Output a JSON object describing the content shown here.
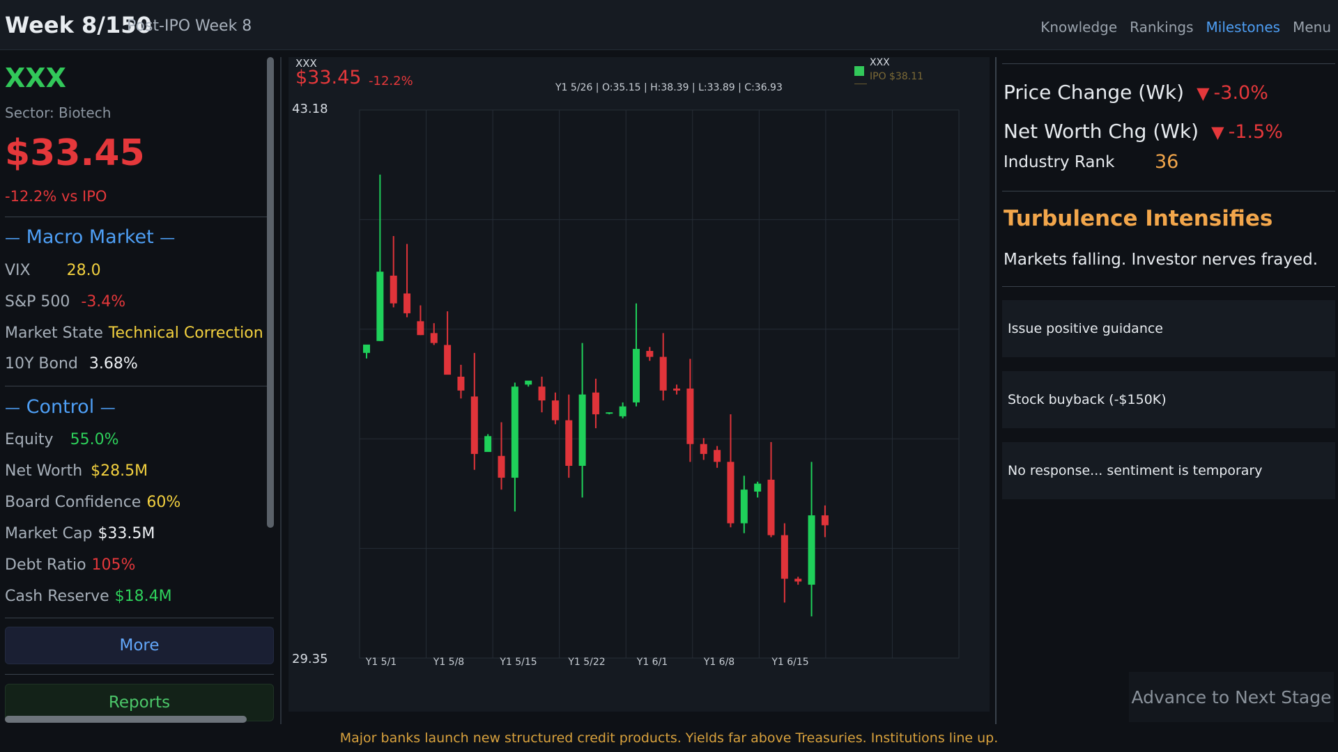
{
  "header": {
    "week": "Week 8/150",
    "subtitle": "Post-IPO Week 8",
    "nav": [
      "Knowledge",
      "Rankings",
      "Milestones",
      "Menu"
    ]
  },
  "company": {
    "ticker": "XXX",
    "sector": "Sector: Biotech",
    "price": "$33.45",
    "vs_ipo": "-12.2% vs IPO"
  },
  "macro": {
    "heading": "Macro Market",
    "rows": [
      {
        "label": "VIX",
        "value": "28.0",
        "color": "#f3d13f"
      },
      {
        "label": "S&P 500",
        "value": "-3.4%",
        "color": "#e5383b"
      },
      {
        "label": "Market State",
        "value": "Technical Correction",
        "color": "#f3d13f"
      },
      {
        "label": "10Y Bond",
        "value": "3.68%",
        "color": "#eef1f4"
      }
    ]
  },
  "control": {
    "heading": "Control",
    "rows": [
      {
        "label": "Equity",
        "value": "55.0%",
        "color": "#2ed15b"
      },
      {
        "label": "Net Worth",
        "value": "$28.5M",
        "color": "#f3d13f"
      },
      {
        "label": "Board Confidence",
        "value": "60%",
        "color": "#f3d13f"
      },
      {
        "label": "Market Cap",
        "value": "$33.5M",
        "color": "#eef1f4"
      },
      {
        "label": "Debt Ratio",
        "value": "105%",
        "color": "#e5383b"
      },
      {
        "label": "Cash Reserve",
        "value": "$18.4M",
        "color": "#2ed15b"
      }
    ]
  },
  "buttons": {
    "more": "More",
    "reports": "Reports",
    "advance": "Advance to Next Stage"
  },
  "chart_header": {
    "ticker": "XXX",
    "price": "$33.45",
    "change": "-12.2%",
    "ohlc": "Y1 5/26 | O:35.15 | H:38.39 | L:33.89 | C:36.93",
    "legend_series": "XXX",
    "legend_ipo": "IPO $38.11"
  },
  "chart_data": {
    "type": "candlestick",
    "x_ticks": [
      "Y1 5/1",
      "Y1 5/8",
      "Y1 5/15",
      "Y1 5/22",
      "Y1 6/1",
      "Y1 6/8",
      "Y1 6/15"
    ],
    "ylim": [
      29.35,
      43.18
    ],
    "ylim_labels": [
      "43.18",
      "29.35"
    ],
    "ipo_price": 38.11,
    "candles": [
      {
        "o": 37.05,
        "h": 37.1,
        "l": 36.91,
        "c": 37.26
      },
      {
        "o": 37.35,
        "h": 41.55,
        "l": 37.35,
        "c": 39.1
      },
      {
        "o": 39.0,
        "h": 40.0,
        "l": 38.2,
        "c": 38.3
      },
      {
        "o": 38.55,
        "h": 39.8,
        "l": 37.95,
        "c": 38.05
      },
      {
        "o": 37.85,
        "h": 38.25,
        "l": 37.5,
        "c": 37.5
      },
      {
        "o": 37.55,
        "h": 37.8,
        "l": 37.25,
        "c": 37.3
      },
      {
        "o": 37.25,
        "h": 38.1,
        "l": 36.85,
        "c": 36.5
      },
      {
        "o": 36.45,
        "h": 36.75,
        "l": 35.9,
        "c": 36.1
      },
      {
        "o": 35.95,
        "h": 37.05,
        "l": 34.1,
        "c": 34.5
      },
      {
        "o": 34.55,
        "h": 35.0,
        "l": 34.65,
        "c": 34.95
      },
      {
        "o": 34.45,
        "h": 35.3,
        "l": 33.6,
        "c": 33.9
      },
      {
        "o": 33.9,
        "h": 36.3,
        "l": 33.05,
        "c": 36.2
      },
      {
        "o": 36.25,
        "h": 36.3,
        "l": 36.2,
        "c": 36.35
      },
      {
        "o": 36.2,
        "h": 36.45,
        "l": 35.55,
        "c": 35.85
      },
      {
        "o": 35.85,
        "h": 36.05,
        "l": 35.25,
        "c": 35.35
      },
      {
        "o": 35.35,
        "h": 36.0,
        "l": 33.9,
        "c": 34.2
      },
      {
        "o": 34.2,
        "h": 37.3,
        "l": 33.4,
        "c": 36.0
      },
      {
        "o": 36.05,
        "h": 36.4,
        "l": 35.15,
        "c": 35.5
      },
      {
        "o": 35.52,
        "h": 35.55,
        "l": 35.5,
        "c": 35.55
      },
      {
        "o": 35.45,
        "h": 35.8,
        "l": 35.4,
        "c": 35.7
      },
      {
        "o": 35.8,
        "h": 38.3,
        "l": 35.7,
        "c": 37.15
      },
      {
        "o": 37.1,
        "h": 37.2,
        "l": 36.85,
        "c": 36.95
      },
      {
        "o": 36.95,
        "h": 37.55,
        "l": 35.85,
        "c": 36.1
      },
      {
        "o": 36.15,
        "h": 36.25,
        "l": 36.0,
        "c": 36.1
      },
      {
        "o": 36.15,
        "h": 36.9,
        "l": 34.3,
        "c": 34.75
      },
      {
        "o": 34.75,
        "h": 34.9,
        "l": 34.35,
        "c": 34.5
      },
      {
        "o": 34.6,
        "h": 34.7,
        "l": 34.15,
        "c": 34.3
      },
      {
        "o": 34.3,
        "h": 35.5,
        "l": 32.65,
        "c": 32.75
      },
      {
        "o": 32.75,
        "h": 33.95,
        "l": 32.5,
        "c": 33.6
      },
      {
        "o": 33.55,
        "h": 33.8,
        "l": 33.4,
        "c": 33.75
      },
      {
        "o": 33.85,
        "h": 34.8,
        "l": 32.4,
        "c": 32.45
      },
      {
        "o": 32.45,
        "h": 32.75,
        "l": 30.75,
        "c": 31.35
      },
      {
        "o": 31.35,
        "h": 31.4,
        "l": 31.2,
        "c": 31.28
      },
      {
        "o": 31.2,
        "h": 34.3,
        "l": 30.4,
        "c": 32.95
      },
      {
        "o": 32.95,
        "h": 33.2,
        "l": 32.4,
        "c": 32.7
      }
    ],
    "colors": {
      "up": "#1fd05a",
      "down": "#e0343a",
      "grid": "#262d36"
    }
  },
  "right_panel": {
    "price_change_label": "Price Change (Wk)",
    "price_change_value": "-3.0%",
    "net_worth_label": "Net Worth Chg (Wk)",
    "net_worth_value": "-1.5%",
    "rank_label": "Industry Rank",
    "rank_value": "36",
    "down_arrow": "▼",
    "event_title": "Turbulence Intensifies",
    "event_desc": "Markets falling. Investor nerves frayed.",
    "options": [
      "Issue positive guidance",
      "Stock buyback (-$150K)",
      "No response... sentiment is temporary"
    ]
  },
  "news_ticker": "Major banks launch new structured credit products. Yields far above Treasuries. Institutions line up."
}
